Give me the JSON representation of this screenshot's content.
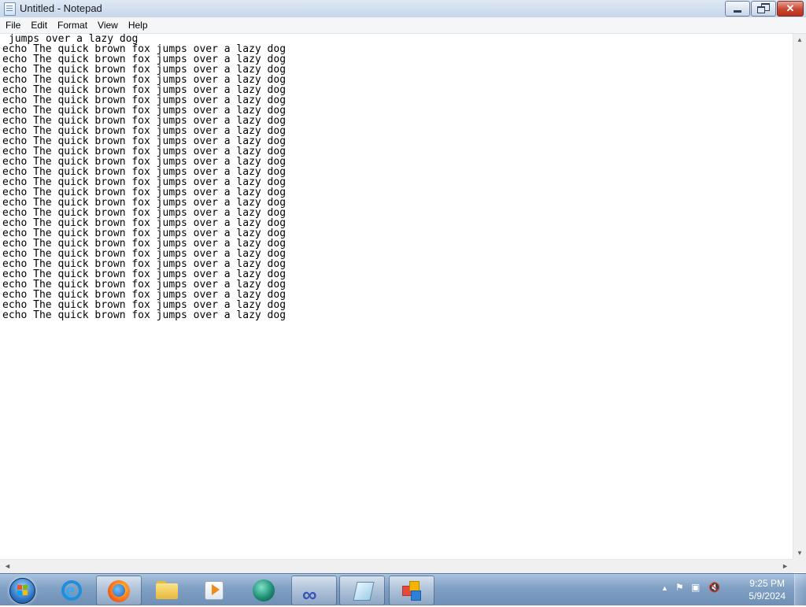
{
  "window": {
    "title": "Untitled - Notepad",
    "buttons": {
      "minimize": "",
      "restore": "",
      "close": "✕"
    }
  },
  "menu": [
    "File",
    "Edit",
    "Format",
    "View",
    "Help"
  ],
  "editor": {
    "first_line": "jumps over a lazy dog",
    "repeated_line": "echo The quick brown fox jumps over a lazy dog",
    "repeat_count": 27
  },
  "scrollbars": {
    "up": "▲",
    "down": "▼",
    "left": "◄",
    "right": "►"
  },
  "taskbar": {
    "start_icon": "windows-orb",
    "apps": [
      {
        "name": "internet-explorer",
        "running": false
      },
      {
        "name": "firefox",
        "running": true
      },
      {
        "name": "file-explorer",
        "running": false
      },
      {
        "name": "media-player",
        "running": false
      },
      {
        "name": "green-sphere-app",
        "running": false
      },
      {
        "name": "infinity-app",
        "running": true
      },
      {
        "name": "notepad",
        "running": true
      },
      {
        "name": "multi-window-app",
        "running": true
      }
    ],
    "tray": {
      "expand_arrow": "▲",
      "clock_time": "9:25 PM",
      "clock_date": "5/9/2024"
    }
  }
}
